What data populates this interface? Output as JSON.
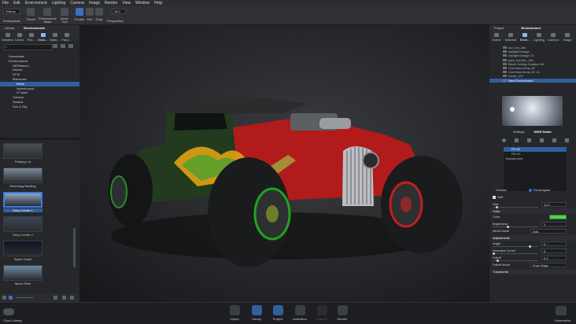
{
  "menu": [
    "File",
    "Edit",
    "Environment",
    "Lighting",
    "Camera",
    "Image",
    "Render",
    "View",
    "Window",
    "Help"
  ],
  "toolbar": {
    "workspace_value": "Startup",
    "workspaces": "Workspaces",
    "theme": "Theme",
    "performance": "Performance\nMode",
    "move_tool": "Move\nTool",
    "tumble": "Tumble",
    "pan": "Pan",
    "dolly": "Dolly",
    "fov_value": "45.0",
    "perspective": "Perspective"
  },
  "library": {
    "tabs": [
      "Library",
      "Environments"
    ],
    "icons": [
      "Meshes",
      "Colors",
      "Text...",
      "Envir...",
      "Back...",
      "Favo..."
    ],
    "tree": [
      {
        "label": "Downloads",
        "indent": 1,
        "selected": false
      },
      {
        "label": "Environments",
        "indent": 1,
        "selected": false
      },
      {
        "label": "HDRIhaven",
        "indent": 2,
        "selected": false
      },
      {
        "label": "Interior",
        "indent": 2,
        "selected": false
      },
      {
        "label": "KF.M",
        "indent": 2,
        "selected": false
      },
      {
        "label": "Marmoset",
        "indent": 2,
        "selected": false
      },
      {
        "label": "Berlin",
        "indent": 3,
        "selected": true
      },
      {
        "label": "Iceland pack",
        "indent": 3,
        "selected": false
      },
      {
        "label": "LP pack",
        "indent": 3,
        "selected": false
      },
      {
        "label": "Outdoor",
        "indent": 2,
        "selected": false
      },
      {
        "label": "Studios",
        "indent": 2,
        "selected": false
      },
      {
        "label": "Sun & Sky",
        "indent": 2,
        "selected": false
      }
    ],
    "thumbs": [
      "Parking Lot",
      "Reichstag Building",
      "Sony Center 1",
      "Sony Center 2",
      "Spree Canal",
      "Spree River"
    ],
    "selected_thumb": 2
  },
  "right": {
    "tabs": [
      "Project",
      "Environment"
    ],
    "icons": [
      "Scene",
      "Material",
      "Envir...",
      "Lighting",
      "Camera",
      "Image"
    ],
    "env_list": [
      "hot_rod_16k",
      "skylightGarage",
      "skylightGarage 10",
      "park_sunrise_16k",
      "Black Ceiling Gradient 4K",
      "Overhead Array 4K",
      "Overhead Array 4K 14",
      "studio_007",
      "New Environment"
    ],
    "env_selected": 8,
    "subtabs": [
      "Settings",
      "HDRI Editor"
    ],
    "layers": [
      "Pin #2",
      "Pin #1",
      "Background"
    ],
    "shape_options": [
      "Circular",
      "Rectangular"
    ],
    "half_label": "Half",
    "size_label": "Size",
    "size_value": "12.2",
    "color_section": "Color",
    "color_label": "Color",
    "color_swatch": "#38e23a",
    "brightness_label": "Brightness",
    "brightness_value": "1",
    "blend_label": "Blend Mode",
    "blend_value": "Add",
    "adjustments": "Adjustments",
    "angle_label": "Angle",
    "angle_value": "0 °",
    "rounded_label": "Rounded Corner",
    "rounded_value": "0",
    "falloff_label": "Falloff",
    "falloff_value": "0.1",
    "falloff_mode_label": "Falloff Mode",
    "falloff_mode_value": "From Edge",
    "transforms": "Transforms"
  },
  "bottom": {
    "cloud": "Cloud Library",
    "items": [
      "Import",
      "Library",
      "Project",
      "Animation",
      "Post FX",
      "Render"
    ],
    "selected": [
      1,
      2
    ],
    "disabled": [
      4
    ],
    "screenshot": "Screenshot"
  }
}
